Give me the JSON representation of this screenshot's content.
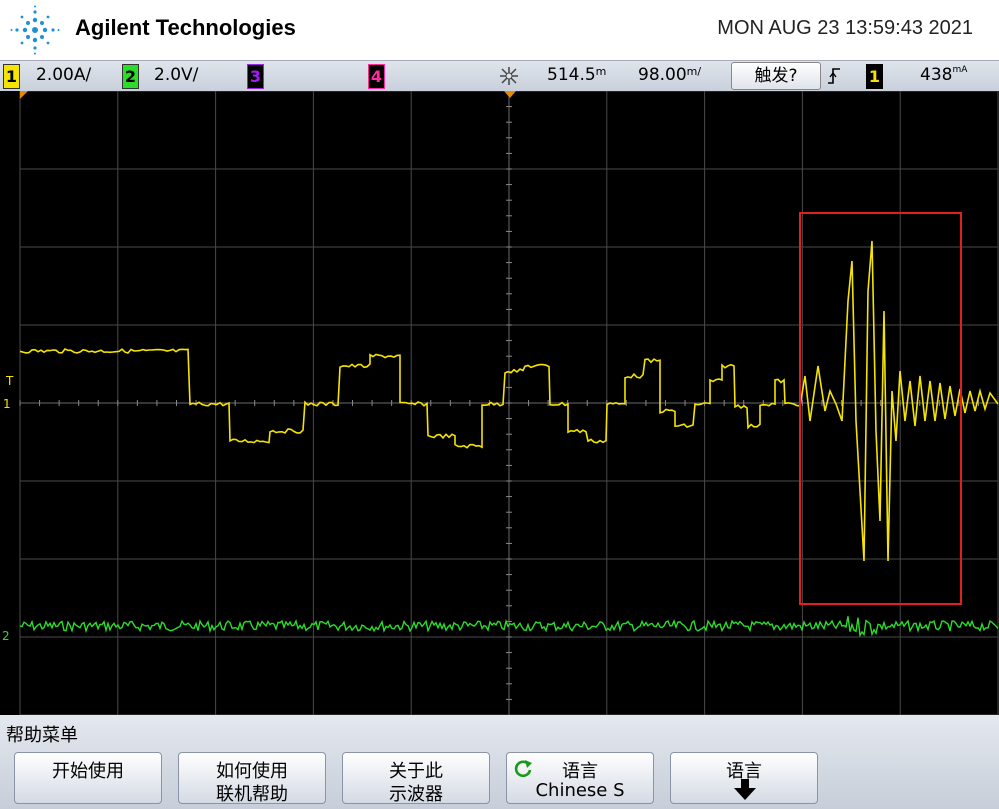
{
  "header": {
    "brand": "Agilent Technologies",
    "datetime": "MON AUG 23 13:59:43 2021"
  },
  "status": {
    "ch1": {
      "num": "1",
      "scale": "2.00A/",
      "color": "#f5e400"
    },
    "ch2": {
      "num": "2",
      "scale": "2.0V/",
      "color": "#2bdc2b"
    },
    "ch3": {
      "num": "3",
      "color": "#a020f0"
    },
    "ch4": {
      "num": "4",
      "color": "#ff2aa0"
    },
    "time_delay": "514.5",
    "time_delay_unit": "m",
    "time_div": "98.00",
    "time_div_unit": "m/",
    "trigger_button": "触发?",
    "trigger_source": "1",
    "trigger_level": "438",
    "trigger_level_unit": "mA"
  },
  "markers": {
    "trigger_label": "T",
    "ch1_ground": "1",
    "ch2_ground": "2"
  },
  "menu": {
    "title": "帮助菜单",
    "softkeys": [
      {
        "line1": "开始使用",
        "line2": ""
      },
      {
        "line1": "如何使用",
        "line2": "联机帮助"
      },
      {
        "line1": "关于此",
        "line2": "示波器"
      },
      {
        "line1": "语言",
        "line2": "Chinese S"
      },
      {
        "line1": "语言",
        "line2": ""
      }
    ]
  },
  "colors": {
    "ch1": "#f5e400",
    "ch2": "#2bdc2b",
    "highlight": "#e02020",
    "grid": "#555555"
  }
}
